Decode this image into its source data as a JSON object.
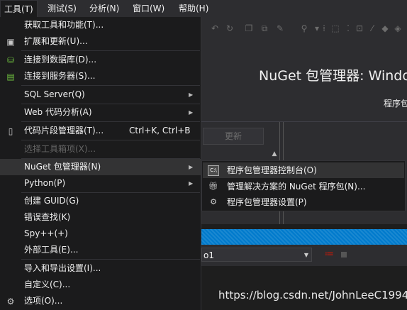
{
  "menubar": {
    "items": [
      {
        "label": "工具(T)"
      },
      {
        "label": "测试(S)"
      },
      {
        "label": "分析(N)"
      },
      {
        "label": "窗口(W)"
      },
      {
        "label": "帮助(H)"
      }
    ]
  },
  "tools_menu": {
    "items": [
      {
        "label": "获取工具和功能(T)...",
        "icon": "",
        "shortcut": "",
        "submenu": false
      },
      {
        "label": "扩展和更新(U)...",
        "icon": "extensions-icon",
        "shortcut": "",
        "submenu": false
      },
      {
        "label": "连接到数据库(D)...",
        "icon": "database-connect-icon",
        "shortcut": "",
        "submenu": false
      },
      {
        "label": "连接到服务器(S)...",
        "icon": "server-connect-icon",
        "shortcut": "",
        "submenu": false
      },
      {
        "label": "SQL Server(Q)",
        "icon": "",
        "shortcut": "",
        "submenu": true
      },
      {
        "label": "Web 代码分析(A)",
        "icon": "",
        "shortcut": "",
        "submenu": true
      },
      {
        "label": "代码片段管理器(T)...",
        "icon": "snippet-icon",
        "shortcut": "Ctrl+K, Ctrl+B",
        "submenu": false
      },
      {
        "label": "选择工具箱项(X)...",
        "icon": "",
        "shortcut": "",
        "submenu": false,
        "disabled": true
      },
      {
        "label": "NuGet 包管理器(N)",
        "icon": "",
        "shortcut": "",
        "submenu": true,
        "highlighted": true
      },
      {
        "label": "Python(P)",
        "icon": "",
        "shortcut": "",
        "submenu": true
      },
      {
        "label": "创建 GUID(G)",
        "icon": "",
        "shortcut": "",
        "submenu": false
      },
      {
        "label": "错误查找(K)",
        "icon": "",
        "shortcut": "",
        "submenu": false
      },
      {
        "label": "Spy++(+)",
        "icon": "",
        "shortcut": "",
        "submenu": false
      },
      {
        "label": "外部工具(E)...",
        "icon": "",
        "shortcut": "",
        "submenu": false
      },
      {
        "label": "导入和导出设置(I)...",
        "icon": "",
        "shortcut": "",
        "submenu": false
      },
      {
        "label": "自定义(C)...",
        "icon": "",
        "shortcut": "",
        "submenu": false
      },
      {
        "label": "选项(O)...",
        "icon": "gear-icon",
        "shortcut": "",
        "submenu": false
      }
    ]
  },
  "nuget_submenu": {
    "items": [
      {
        "label": "程序包管理器控制台(O)",
        "icon": "console-icon",
        "highlighted": true
      },
      {
        "label": "管理解决方案的 NuGet 程序包(N)...",
        "icon": "package-icon"
      },
      {
        "label": "程序包管理器设置(P)",
        "icon": "gear-icon"
      }
    ]
  },
  "background": {
    "doc_title": "NuGet 包管理器: Windo",
    "doc_subtitle": "程序包",
    "update_button": "更新",
    "package_source_value": "o1",
    "watermark": "https://blog.csdn.net/JohnLeeC1994"
  },
  "colors": {
    "menu_bg": "#1b1b1c",
    "ide_bg": "#2d2d30",
    "highlight": "#333334",
    "accent_blue": "#007acc"
  }
}
